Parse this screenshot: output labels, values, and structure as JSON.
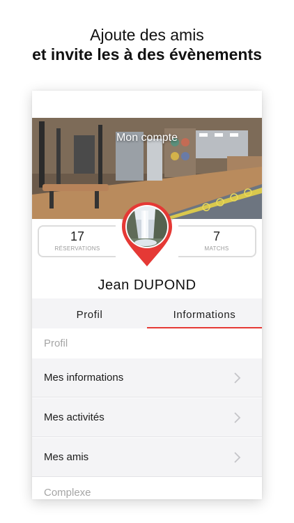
{
  "headline": {
    "line1": "Ajoute des amis",
    "line2": "et invite les à des évènements"
  },
  "hero": {
    "title": "Mon compte"
  },
  "stats": {
    "reservations": {
      "value": "17",
      "label": "RÉSERVATIONS"
    },
    "matchs": {
      "value": "7",
      "label": "MATCHS"
    }
  },
  "profile": {
    "name": "Jean  DUPOND"
  },
  "tabs": [
    {
      "label": "Profil"
    },
    {
      "label": "Informations"
    }
  ],
  "sections": {
    "profil_header": "Profil",
    "complexe_header": "Complexe"
  },
  "menu": [
    {
      "label": "Mes informations",
      "icon": "chevron-right-icon"
    },
    {
      "label": "Mes activités",
      "icon": "chevron-right-icon"
    },
    {
      "label": "Mes amis",
      "icon": "chevron-right-icon"
    }
  ],
  "colors": {
    "accent": "#e53935",
    "list_background": "#f4f4f6",
    "section_text": "#a5a5a5"
  }
}
